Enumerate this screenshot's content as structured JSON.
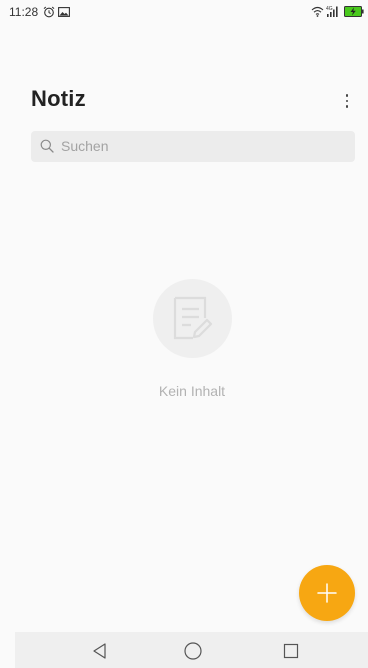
{
  "status_bar": {
    "time": "11:28",
    "icons": [
      "alarm-icon",
      "image-icon",
      "wifi-icon",
      "signal-icon",
      "battery-charging-icon"
    ],
    "battery_color": "#49c91d"
  },
  "header": {
    "title": "Notiz",
    "menu_icon": "more-vertical-icon"
  },
  "search": {
    "placeholder": "Suchen",
    "value": "",
    "icon": "search-icon"
  },
  "empty_state": {
    "icon": "note-edit-icon",
    "text": "Kein Inhalt"
  },
  "fab": {
    "icon": "plus-icon",
    "color": "#f7a712"
  },
  "navigation_bar": {
    "buttons": [
      "back-icon",
      "home-icon",
      "recents-icon"
    ]
  }
}
